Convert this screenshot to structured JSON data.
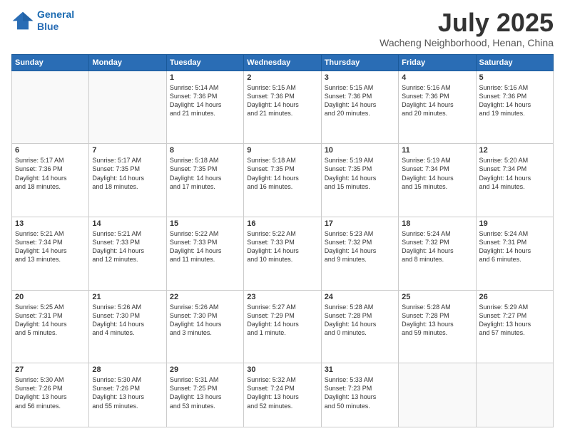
{
  "header": {
    "logo_line1": "General",
    "logo_line2": "Blue",
    "month_title": "July 2025",
    "location": "Wacheng Neighborhood, Henan, China"
  },
  "weekdays": [
    "Sunday",
    "Monday",
    "Tuesday",
    "Wednesday",
    "Thursday",
    "Friday",
    "Saturday"
  ],
  "weeks": [
    [
      {
        "day": "",
        "content": ""
      },
      {
        "day": "",
        "content": ""
      },
      {
        "day": "1",
        "content": "Sunrise: 5:14 AM\nSunset: 7:36 PM\nDaylight: 14 hours\nand 21 minutes."
      },
      {
        "day": "2",
        "content": "Sunrise: 5:15 AM\nSunset: 7:36 PM\nDaylight: 14 hours\nand 21 minutes."
      },
      {
        "day": "3",
        "content": "Sunrise: 5:15 AM\nSunset: 7:36 PM\nDaylight: 14 hours\nand 20 minutes."
      },
      {
        "day": "4",
        "content": "Sunrise: 5:16 AM\nSunset: 7:36 PM\nDaylight: 14 hours\nand 20 minutes."
      },
      {
        "day": "5",
        "content": "Sunrise: 5:16 AM\nSunset: 7:36 PM\nDaylight: 14 hours\nand 19 minutes."
      }
    ],
    [
      {
        "day": "6",
        "content": "Sunrise: 5:17 AM\nSunset: 7:36 PM\nDaylight: 14 hours\nand 18 minutes."
      },
      {
        "day": "7",
        "content": "Sunrise: 5:17 AM\nSunset: 7:35 PM\nDaylight: 14 hours\nand 18 minutes."
      },
      {
        "day": "8",
        "content": "Sunrise: 5:18 AM\nSunset: 7:35 PM\nDaylight: 14 hours\nand 17 minutes."
      },
      {
        "day": "9",
        "content": "Sunrise: 5:18 AM\nSunset: 7:35 PM\nDaylight: 14 hours\nand 16 minutes."
      },
      {
        "day": "10",
        "content": "Sunrise: 5:19 AM\nSunset: 7:35 PM\nDaylight: 14 hours\nand 15 minutes."
      },
      {
        "day": "11",
        "content": "Sunrise: 5:19 AM\nSunset: 7:34 PM\nDaylight: 14 hours\nand 15 minutes."
      },
      {
        "day": "12",
        "content": "Sunrise: 5:20 AM\nSunset: 7:34 PM\nDaylight: 14 hours\nand 14 minutes."
      }
    ],
    [
      {
        "day": "13",
        "content": "Sunrise: 5:21 AM\nSunset: 7:34 PM\nDaylight: 14 hours\nand 13 minutes."
      },
      {
        "day": "14",
        "content": "Sunrise: 5:21 AM\nSunset: 7:33 PM\nDaylight: 14 hours\nand 12 minutes."
      },
      {
        "day": "15",
        "content": "Sunrise: 5:22 AM\nSunset: 7:33 PM\nDaylight: 14 hours\nand 11 minutes."
      },
      {
        "day": "16",
        "content": "Sunrise: 5:22 AM\nSunset: 7:33 PM\nDaylight: 14 hours\nand 10 minutes."
      },
      {
        "day": "17",
        "content": "Sunrise: 5:23 AM\nSunset: 7:32 PM\nDaylight: 14 hours\nand 9 minutes."
      },
      {
        "day": "18",
        "content": "Sunrise: 5:24 AM\nSunset: 7:32 PM\nDaylight: 14 hours\nand 8 minutes."
      },
      {
        "day": "19",
        "content": "Sunrise: 5:24 AM\nSunset: 7:31 PM\nDaylight: 14 hours\nand 6 minutes."
      }
    ],
    [
      {
        "day": "20",
        "content": "Sunrise: 5:25 AM\nSunset: 7:31 PM\nDaylight: 14 hours\nand 5 minutes."
      },
      {
        "day": "21",
        "content": "Sunrise: 5:26 AM\nSunset: 7:30 PM\nDaylight: 14 hours\nand 4 minutes."
      },
      {
        "day": "22",
        "content": "Sunrise: 5:26 AM\nSunset: 7:30 PM\nDaylight: 14 hours\nand 3 minutes."
      },
      {
        "day": "23",
        "content": "Sunrise: 5:27 AM\nSunset: 7:29 PM\nDaylight: 14 hours\nand 1 minute."
      },
      {
        "day": "24",
        "content": "Sunrise: 5:28 AM\nSunset: 7:28 PM\nDaylight: 14 hours\nand 0 minutes."
      },
      {
        "day": "25",
        "content": "Sunrise: 5:28 AM\nSunset: 7:28 PM\nDaylight: 13 hours\nand 59 minutes."
      },
      {
        "day": "26",
        "content": "Sunrise: 5:29 AM\nSunset: 7:27 PM\nDaylight: 13 hours\nand 57 minutes."
      }
    ],
    [
      {
        "day": "27",
        "content": "Sunrise: 5:30 AM\nSunset: 7:26 PM\nDaylight: 13 hours\nand 56 minutes."
      },
      {
        "day": "28",
        "content": "Sunrise: 5:30 AM\nSunset: 7:26 PM\nDaylight: 13 hours\nand 55 minutes."
      },
      {
        "day": "29",
        "content": "Sunrise: 5:31 AM\nSunset: 7:25 PM\nDaylight: 13 hours\nand 53 minutes."
      },
      {
        "day": "30",
        "content": "Sunrise: 5:32 AM\nSunset: 7:24 PM\nDaylight: 13 hours\nand 52 minutes."
      },
      {
        "day": "31",
        "content": "Sunrise: 5:33 AM\nSunset: 7:23 PM\nDaylight: 13 hours\nand 50 minutes."
      },
      {
        "day": "",
        "content": ""
      },
      {
        "day": "",
        "content": ""
      }
    ]
  ]
}
